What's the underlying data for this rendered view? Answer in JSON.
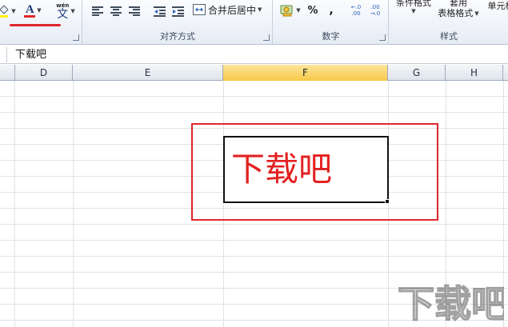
{
  "ribbon": {
    "font": {
      "font_color_letter": "A",
      "phonetic_top": "wén",
      "phonetic_bottom": "文"
    },
    "alignment": {
      "label": "对齐方式",
      "merge_button": "合并后居中"
    },
    "number": {
      "label": "数字",
      "percent": "%",
      "comma": ",",
      "inc_decimal": "←.0 .00",
      "dec_decimal": ".00 →.0"
    },
    "styles": {
      "label": "样式",
      "conditional": "条件格式",
      "table_top": "套用",
      "table_bottom": "表格格式",
      "cell": "单元格"
    }
  },
  "formula_bar": {
    "value": "下载吧"
  },
  "columns": [
    "D",
    "E",
    "F",
    "G",
    "H"
  ],
  "active_column": "F",
  "cell": {
    "value": "下载吧"
  },
  "colors": {
    "accent_red": "#e0262c",
    "text_red": "#e32020",
    "active_header": "#f8c84a"
  },
  "watermark": {
    "text": "下载吧"
  }
}
